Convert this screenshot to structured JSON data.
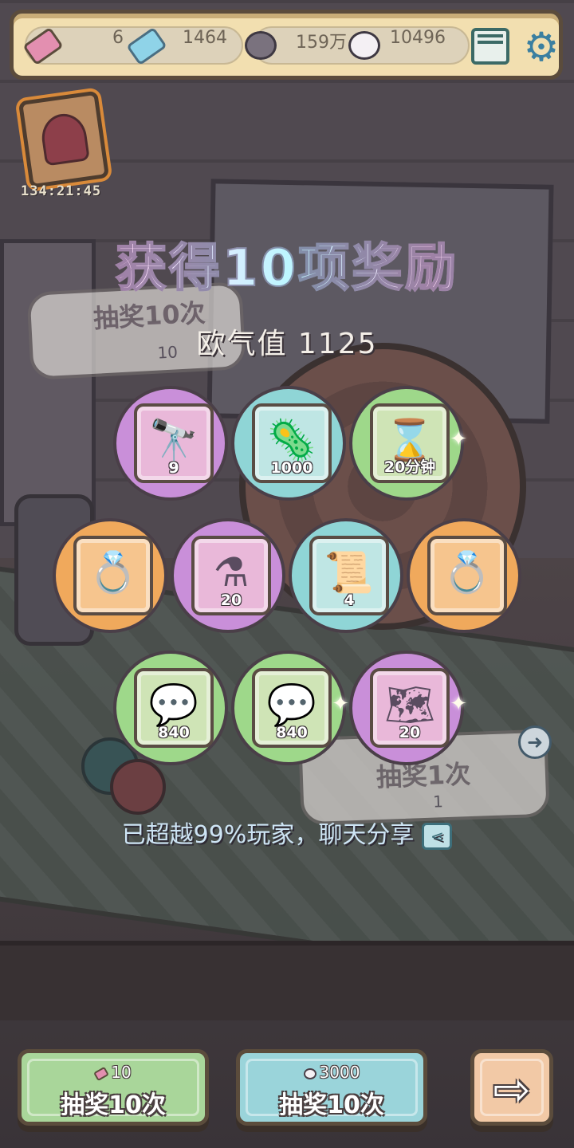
{
  "top_bar": {
    "tickets": "6",
    "blue_tickets": "1464",
    "dark_bubbles": "159万",
    "light_bubbles": "10496",
    "icons": [
      "ticket-icon",
      "blue-ticket-icon",
      "dark-bubble-icon",
      "light-bubble-icon",
      "mail-icon",
      "gear-icon"
    ]
  },
  "event": {
    "timer": "134:21:45"
  },
  "background_panels": {
    "left": {
      "label": "抽奖10次",
      "cost": "10"
    },
    "right": {
      "label": "抽奖1次",
      "cost": "1"
    }
  },
  "result": {
    "title": "获得10项奖励",
    "luck_label": "欧气值",
    "luck_value": "1125",
    "rewards": [
      {
        "item": "telescope",
        "glyph": "🔭",
        "qty": "9",
        "color": "purple"
      },
      {
        "item": "germ",
        "glyph": "🦠",
        "qty": "1000",
        "color": "teal"
      },
      {
        "item": "hourglass",
        "glyph": "⌛",
        "qty": "20分钟",
        "color": "green"
      },
      {
        "item": "ring",
        "glyph": "💍",
        "qty": "",
        "color": "orange"
      },
      {
        "item": "potion-bottle",
        "glyph": "⚗",
        "qty": "20",
        "color": "purple"
      },
      {
        "item": "scroll",
        "glyph": "📜",
        "qty": "4",
        "color": "teal"
      },
      {
        "item": "ring",
        "glyph": "💍",
        "qty": "",
        "color": "orange"
      },
      {
        "item": "dark-bubble",
        "glyph": "💬",
        "qty": "840",
        "color": "green"
      },
      {
        "item": "dark-bubble",
        "glyph": "💬",
        "qty": "840",
        "color": "green"
      },
      {
        "item": "map-scroll",
        "glyph": "🗺",
        "qty": "20",
        "color": "purple"
      }
    ],
    "share_text": "已超越99%玩家，聊天分享"
  },
  "buttons": {
    "draw10_ticket": {
      "cost": "10",
      "label": "抽奖10次"
    },
    "draw10_bubble": {
      "cost": "3000",
      "label": "抽奖10次"
    },
    "next": {
      "glyph": "⇨"
    }
  }
}
